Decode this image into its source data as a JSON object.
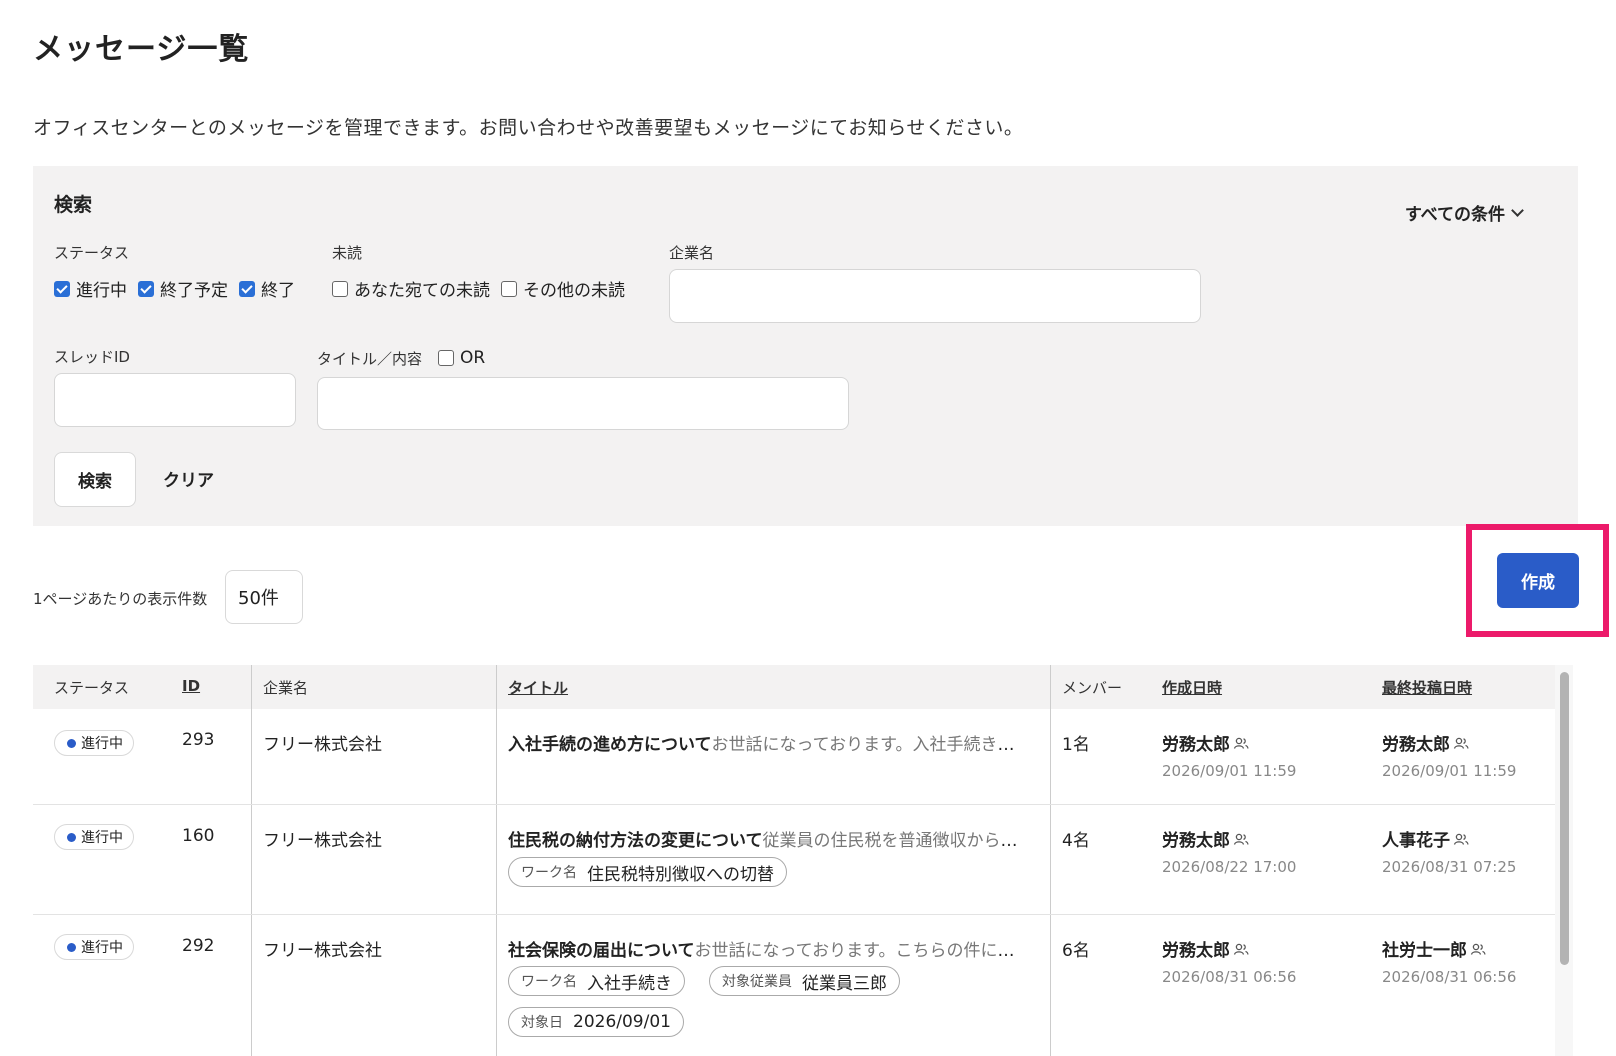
{
  "page": {
    "title": "メッセージ一覧",
    "description": "オフィスセンターとのメッセージを管理できます。お問い合わせや改善要望もメッセージにてお知らせください。"
  },
  "search": {
    "heading": "検索",
    "all_conditions": "すべての条件",
    "status_label": "ステータス",
    "status_options": [
      {
        "label": "進行中",
        "checked": true
      },
      {
        "label": "終了予定",
        "checked": true
      },
      {
        "label": "終了",
        "checked": true
      }
    ],
    "unread_label": "未読",
    "unread_options": [
      {
        "label": "あなた宛ての未読",
        "checked": false
      },
      {
        "label": "その他の未読",
        "checked": false
      }
    ],
    "company_label": "企業名",
    "company_value": "",
    "thread_label": "スレッドID",
    "thread_value": "",
    "title_label": "タイトル／内容",
    "or_label": "OR",
    "or_checked": false,
    "title_value": "",
    "search_button": "検索",
    "clear_button": "クリア"
  },
  "pagination": {
    "per_page_label": "1ページあたりの表示件数",
    "per_page_value": "50件"
  },
  "actions": {
    "create_button": "作成"
  },
  "table": {
    "headers": {
      "status": "ステータス",
      "id": "ID",
      "company": "企業名",
      "title": "タイトル",
      "members": "メンバー",
      "created": "作成日時",
      "last_post": "最終投稿日時"
    },
    "rows": [
      {
        "status": "進行中",
        "id": "293",
        "company": "フリー株式会社",
        "title": "入社手続の進め方について",
        "preview": "お世話になっております。入社手続きについてご相談させてください。",
        "members": "1名",
        "created_by": "労務太郎",
        "created_at": "2026/09/01 11:59",
        "last_by": "労務太郎",
        "last_at": "2026/09/01 11:59",
        "tags": []
      },
      {
        "status": "進行中",
        "id": "160",
        "company": "フリー株式会社",
        "title": "住民税の納付方法の変更について",
        "preview": "従業員の住民税を普通徴収から特別徴収へ切り替えたいと考えております。",
        "members": "4名",
        "created_by": "労務太郎",
        "created_at": "2026/08/22 17:00",
        "last_by": "人事花子",
        "last_at": "2026/08/31 07:25",
        "tags": [
          {
            "key": "ワーク名",
            "value": "住民税特別徴収への切替"
          }
        ]
      },
      {
        "status": "進行中",
        "id": "292",
        "company": "フリー株式会社",
        "title": "社会保険の届出について",
        "preview": "お世話になっております。こちらの件についてご確認をお願いいたします。",
        "members": "6名",
        "created_by": "労務太郎",
        "created_at": "2026/08/31 06:56",
        "last_by": "社労士一郎",
        "last_at": "2026/08/31 06:56",
        "tags": [
          {
            "key": "ワーク名",
            "value": "入社手続き"
          },
          {
            "key": "対象従業員",
            "value": "従業員三郎"
          },
          {
            "key": "対象日",
            "value": "2026/09/01"
          }
        ]
      }
    ]
  },
  "colors": {
    "accent": "#2a5cc8",
    "checkbox": "#2a6fd6",
    "highlight": "#ec1a6a",
    "panel": "#f3f2f2"
  }
}
